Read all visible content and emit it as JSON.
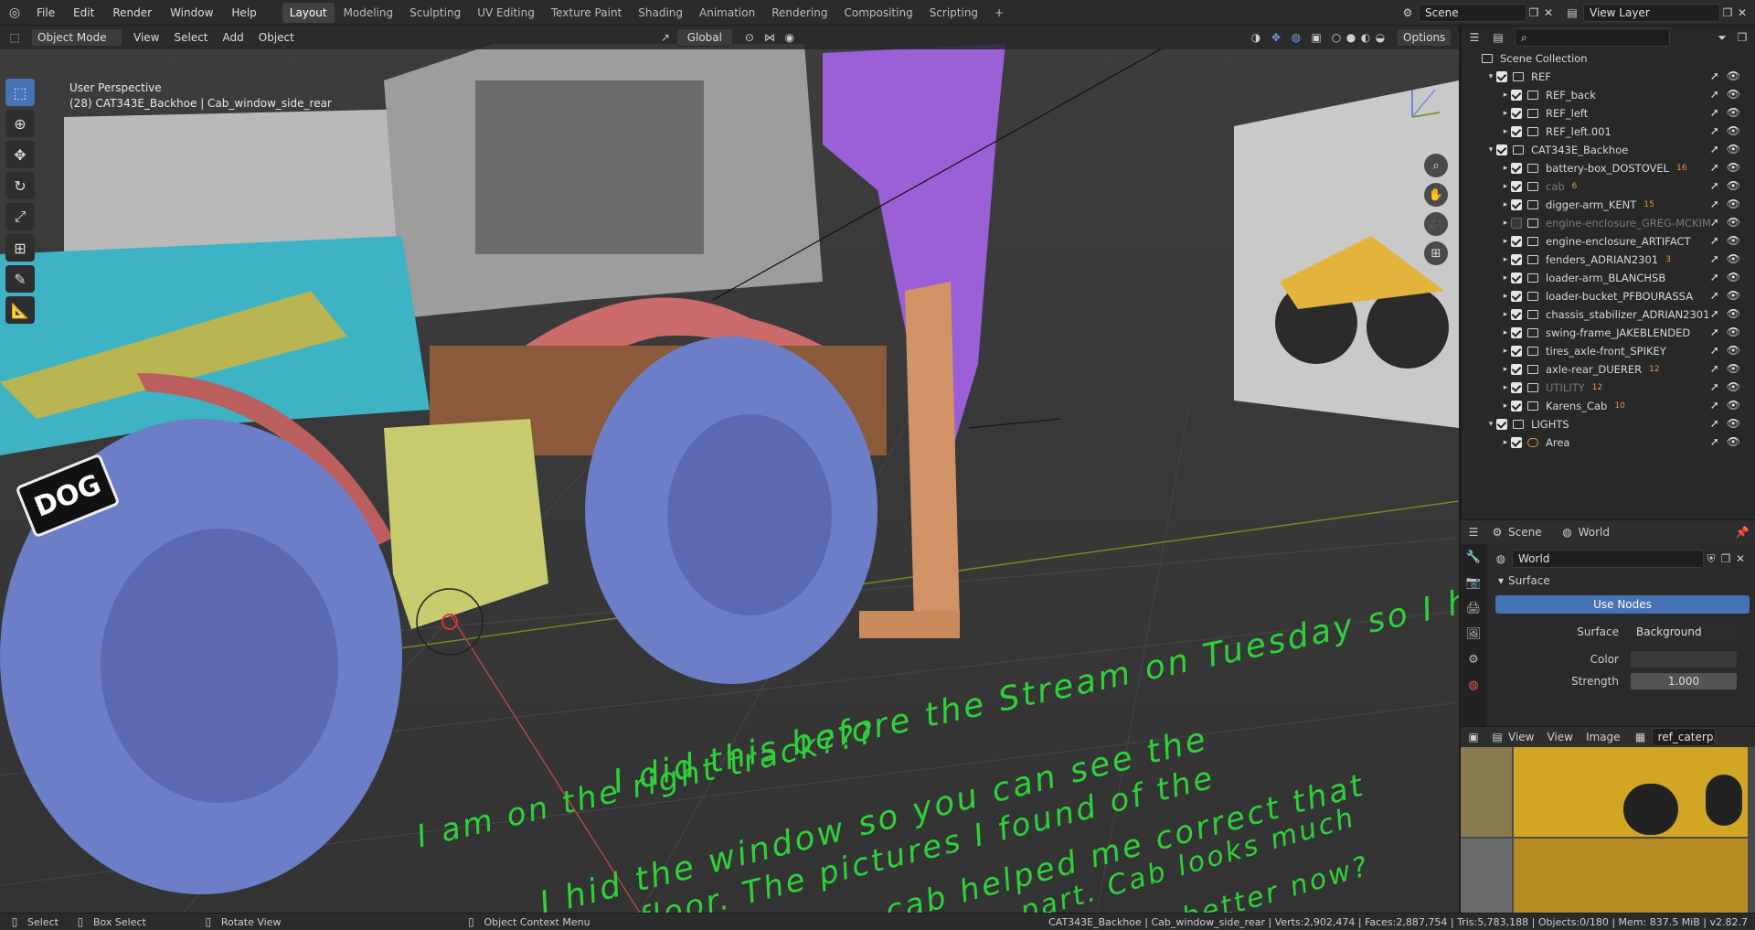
{
  "topbar": {
    "menus": [
      "File",
      "Edit",
      "Render",
      "Window",
      "Help"
    ],
    "workspaces": [
      "Layout",
      "Modeling",
      "Sculpting",
      "UV Editing",
      "Texture Paint",
      "Shading",
      "Animation",
      "Rendering",
      "Compositing",
      "Scripting"
    ],
    "active_workspace": "Layout",
    "add_tab": "+",
    "scene_name": "Scene",
    "view_layer": "View Layer"
  },
  "viewport": {
    "mode": "Object Mode",
    "menus": [
      "View",
      "Select",
      "Add",
      "Object"
    ],
    "orientation": "Global",
    "options": "Options",
    "perspective": "User Perspective",
    "active_object": "(28) CAT343E_Backhoe | Cab_window_side_rear",
    "logo_text": "DOG",
    "note_lines": [
      "I did this before the Stream on Tuesday so I hope",
      "I am on the right track???",
      "I hid the window so you can see the",
      "floor. The pictures I found of the",
      "cab helped me correct that",
      "part. Cab looks much",
      "better now?"
    ],
    "colors": {
      "loader": "#3db3c3",
      "tires": "#6c7ec8",
      "fender": "#cc6b6b",
      "body": "#9a9a9a",
      "arm": "#9b5fd6",
      "stabilizer": "#d29466",
      "step": "#c7cb6e",
      "note": "#2fd13a"
    }
  },
  "outliner": {
    "search_placeholder": "",
    "root": "Scene Collection",
    "rows": [
      {
        "label": "REF",
        "level": 0,
        "checked": true,
        "dim": false
      },
      {
        "label": "REF_back",
        "level": 1,
        "checked": true,
        "dim": false
      },
      {
        "label": "REF_left",
        "level": 1,
        "checked": true,
        "dim": false
      },
      {
        "label": "REF_left.001",
        "level": 1,
        "checked": true,
        "dim": false
      },
      {
        "label": "CAT343E_Backhoe",
        "level": 0,
        "checked": true,
        "dim": false
      },
      {
        "label": "battery-box_DOSTOVEL",
        "level": 1,
        "checked": true,
        "dim": false,
        "badge": "16"
      },
      {
        "label": "cab",
        "level": 1,
        "checked": true,
        "dim": true,
        "badge": "6"
      },
      {
        "label": "digger-arm_KENT",
        "level": 1,
        "checked": true,
        "dim": false,
        "badge": "15"
      },
      {
        "label": "engine-enclosure_GREG-MCKIM",
        "level": 1,
        "checked": false,
        "dim": true
      },
      {
        "label": "engine-enclosure_ARTIFACT",
        "level": 1,
        "checked": true,
        "dim": false
      },
      {
        "label": "fenders_ADRIAN2301",
        "level": 1,
        "checked": true,
        "dim": false,
        "badge": "3"
      },
      {
        "label": "loader-arm_BLANCHSB",
        "level": 1,
        "checked": true,
        "dim": false
      },
      {
        "label": "loader-bucket_PFBOURASSA",
        "level": 1,
        "checked": true,
        "dim": false
      },
      {
        "label": "chassis_stabilizer_ADRIAN2301",
        "level": 1,
        "checked": true,
        "dim": false
      },
      {
        "label": "swing-frame_JAKEBLENDED",
        "level": 1,
        "checked": true,
        "dim": false
      },
      {
        "label": "tires_axle-front_SPIKEY",
        "level": 1,
        "checked": true,
        "dim": false
      },
      {
        "label": "axle-rear_DUERER",
        "level": 1,
        "checked": true,
        "dim": false,
        "badge": "12"
      },
      {
        "label": "UTILITY",
        "level": 1,
        "checked": true,
        "dim": true,
        "badge": "12"
      },
      {
        "label": "Karens_Cab",
        "level": 1,
        "checked": true,
        "dim": false,
        "badge": "10"
      },
      {
        "label": "LIGHTS",
        "level": 0,
        "checked": true,
        "dim": false
      },
      {
        "label": "Area",
        "level": 1,
        "checked": true,
        "dim": false,
        "light": true
      }
    ]
  },
  "properties": {
    "scene_tab": "Scene",
    "world_tab": "World",
    "world_name": "World",
    "panel": "Surface",
    "use_nodes": "Use Nodes",
    "surface_label": "Surface",
    "surface_value": "Background",
    "color_label": "Color",
    "strength_label": "Strength",
    "strength_value": "1.000"
  },
  "image_editor": {
    "menus": [
      "View",
      "View",
      "Image"
    ],
    "image_name": "ref_caterp..xt"
  },
  "statusbar": {
    "select": "Select",
    "box_select": "Box Select",
    "rotate": "Rotate View",
    "context": "Object Context Menu",
    "stats": "CAT343E_Backhoe | Cab_window_side_rear | Verts:2,902,474 | Faces:2,887,754 | Tris:5,783,188 | Objects:0/180 | Mem: 837.5 MiB | v2.82.7"
  }
}
